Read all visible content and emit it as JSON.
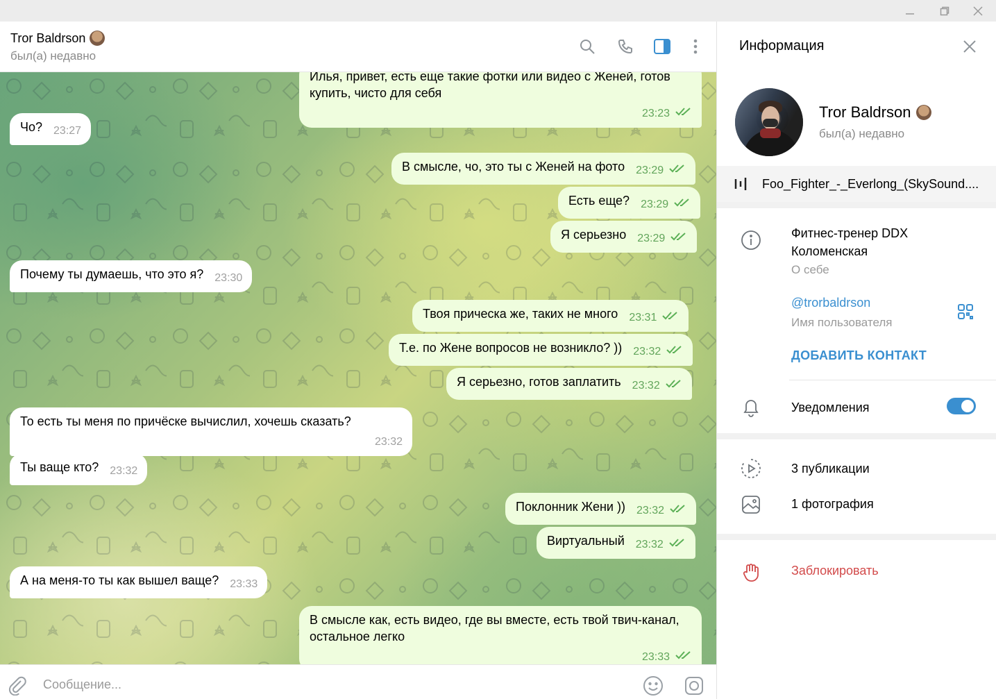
{
  "window": {
    "controls": [
      "minimize",
      "maximize",
      "close"
    ]
  },
  "header": {
    "peer_name": "Tror Baldrson",
    "peer_status": "был(а) недавно",
    "icons": [
      "search-icon",
      "phone-icon",
      "sidebar-toggle-icon",
      "more-icon"
    ]
  },
  "messages": [
    {
      "dir": "out",
      "text": "Илья, привет, есть еще такие фотки или видео с Женей, готов купить, чисто для себя",
      "time": "23:23"
    },
    {
      "dir": "in",
      "text": "Чо?",
      "time": "23:27"
    },
    {
      "dir": "out",
      "text": "В смысле, чо, это ты с Женей на фото",
      "time": "23:29"
    },
    {
      "dir": "out",
      "text": "Есть еще?",
      "time": "23:29"
    },
    {
      "dir": "out",
      "text": "Я серьезно",
      "time": "23:29"
    },
    {
      "dir": "in",
      "text": "Почему ты думаешь, что это я?",
      "time": "23:30"
    },
    {
      "dir": "out",
      "text": "Твоя прическа же, таких не много",
      "time": "23:31"
    },
    {
      "dir": "out",
      "text": "Т.е. по Жене вопросов не возникло? ))",
      "time": "23:32"
    },
    {
      "dir": "out",
      "text": "Я серьезно, готов заплатить",
      "time": "23:32"
    },
    {
      "dir": "in",
      "text": "То есть ты меня по причёске вычислил, хочешь сказать?",
      "time": "23:32"
    },
    {
      "dir": "in",
      "text": "Ты ваще кто?",
      "time": "23:32"
    },
    {
      "dir": "out",
      "text": "Поклонник Жени ))",
      "time": "23:32"
    },
    {
      "dir": "out",
      "text": "Виртуальный",
      "time": "23:32"
    },
    {
      "dir": "in",
      "text": "А на меня-то ты как вышел ваще?",
      "time": "23:33"
    },
    {
      "dir": "out",
      "text": "В смысле как, есть видео, где вы вместе, есть твой твич-канал, остальное легко",
      "time": "23:33"
    }
  ],
  "composer": {
    "placeholder": "Сообщение...",
    "icons": [
      "attach-icon",
      "emoji-icon",
      "camera-icon"
    ]
  },
  "info": {
    "title": "Информация",
    "name": "Tror Baldrson",
    "status": "был(а) недавно",
    "music": "Foo_Fighter_-_Everlong_(SkySound....",
    "bio": "Фитнес-тренер DDX Коломенская",
    "bio_label": "О себе",
    "username": "@trorbaldrson",
    "username_label": "Имя пользователя",
    "add_contact": "ДОБАВИТЬ КОНТАКТ",
    "notifications": "Уведомления",
    "notifications_on": true,
    "posts": "3 публикации",
    "photos": "1 фотография",
    "block": "Заблокировать"
  },
  "colors": {
    "accent": "#3a8fd0",
    "outgoing_bubble": "#effdde",
    "incoming_bubble": "#ffffff",
    "check": "#5cb057",
    "danger": "#d24a4a"
  }
}
